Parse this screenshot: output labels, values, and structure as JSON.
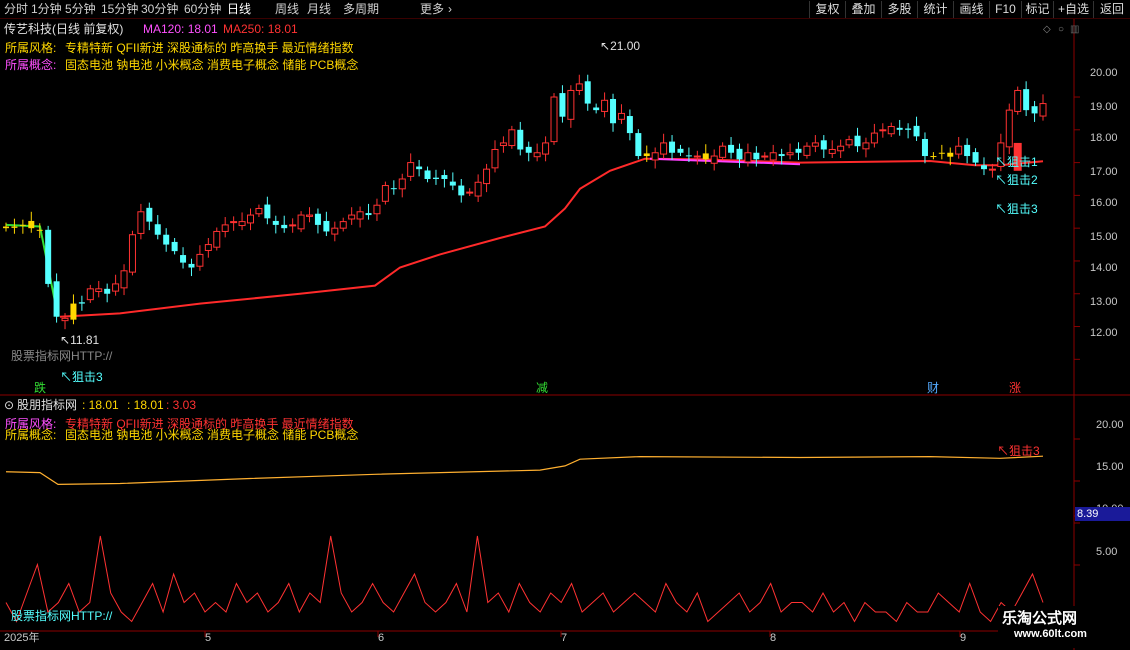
{
  "toolbar": {
    "periods": [
      "分时",
      "1分钟",
      "5分钟",
      "15分钟",
      "30分钟",
      "60分钟",
      "日线",
      "周线",
      "月线",
      "多周期",
      "更多"
    ],
    "active_period": "日线",
    "more_arrow": "›",
    "right_buttons": [
      "复权",
      "叠加",
      "多股",
      "统计",
      "画线",
      "F10",
      "标记",
      "+自选",
      "返回"
    ]
  },
  "main": {
    "stock_title": "传艺科技(日线 前复权)",
    "ma120_label": "MA120: 18.01",
    "ma250_label": "MA250: 18.01",
    "style_label": "所属风格:",
    "style_value": "专精特新 QFII新进 深股通标的 昨高换手 最近情绪指数",
    "concept_label": "所属概念:",
    "concept_value": "固态电池 钠电池 小米概念 消费电子概念 储能 PCB概念",
    "watermark_text": "股票指标网HTTP://",
    "high_annotation": "21.00",
    "low_annotation": "11.81",
    "signals": [
      "↖狙击1",
      "↖狙击2",
      "↖狙击3"
    ],
    "bottom_signal": "↖狙击3",
    "price_axis": [
      "21.00",
      "20.00",
      "19.00",
      "18.00",
      "17.00",
      "16.00",
      "15.00",
      "14.00",
      "13.00",
      "12.00"
    ],
    "event_labels": [
      "跌",
      "减",
      "财",
      "涨"
    ]
  },
  "sub": {
    "indicator_name": "股朋指标网",
    "value1": ": 18.01",
    "value2": ": 18.01",
    "value3": ": 3.03",
    "style_label": "所属风格:",
    "style_value": "专精特新 QFII新进 深股通标的 昨高换手 最近情绪指数",
    "concept_label": "所属概念:",
    "concept_value": "固态电池 钠电池 小米概念 消费电子概念 储能 PCB概念",
    "signal": "↖狙击3",
    "watermark_text": "股票指标网HTTP://",
    "axis": [
      "20.00",
      "15.00",
      "10.00",
      "5.00"
    ],
    "current_value": "8.39"
  },
  "dates": [
    "2025年",
    "5",
    "6",
    "7",
    "8",
    "9"
  ],
  "site": {
    "name": "乐淘公式网",
    "url": "www.60lt.com"
  },
  "colors": {
    "up": "#ff3232",
    "down": "#54ffff",
    "ma": "#ff2a2a",
    "yellow": "#ffd700",
    "magenta": "#ff40ff",
    "green": "#33dd33"
  },
  "chart_data": {
    "type": "candlestick",
    "series_close": [
      16.05,
      16.05,
      16.1,
      16.0,
      15.95,
      14.3,
      13.3,
      13.25,
      13.7,
      13.7,
      14.15,
      14.15,
      14.0,
      14.3,
      14.7,
      15.8,
      16.5,
      16.2,
      15.8,
      15.5,
      15.3,
      14.95,
      14.8,
      15.2,
      15.5,
      15.9,
      16.1,
      16.2,
      16.2,
      16.4,
      16.6,
      16.3,
      16.1,
      16.0,
      16.1,
      16.4,
      16.4,
      16.1,
      15.9,
      16.0,
      16.2,
      16.4,
      16.5,
      16.4,
      16.7,
      17.3,
      17.2,
      17.5,
      18.0,
      17.8,
      17.5,
      17.5,
      17.5,
      17.3,
      17.0,
      17.1,
      17.4,
      17.8,
      18.4,
      18.6,
      19.0,
      18.4,
      18.3,
      18.3,
      18.6,
      20.0,
      19.4,
      20.2,
      20.4,
      19.8,
      19.6,
      19.9,
      19.2,
      19.5,
      18.9,
      18.2,
      18.2,
      18.3,
      18.6,
      18.3,
      18.3,
      18.2,
      18.2,
      18.1,
      18.2,
      18.5,
      18.3,
      18.1,
      18.3,
      18.1,
      18.2,
      18.3,
      18.2,
      18.3,
      18.3,
      18.5,
      18.6,
      18.4,
      18.4,
      18.5,
      18.7,
      18.5,
      18.6,
      18.9,
      19.0,
      19.1,
      19.0,
      19.0,
      18.8,
      18.2,
      18.2,
      18.3,
      18.3,
      18.5,
      18.2,
      18.0,
      17.8,
      17.8,
      18.6,
      19.6,
      20.2,
      19.6,
      19.5,
      19.8
    ],
    "ma_line": {
      "start": 13.3,
      "end": 18.01
    },
    "high": 21.0,
    "low": 11.81,
    "ylim": [
      11.4,
      21.8
    ]
  }
}
